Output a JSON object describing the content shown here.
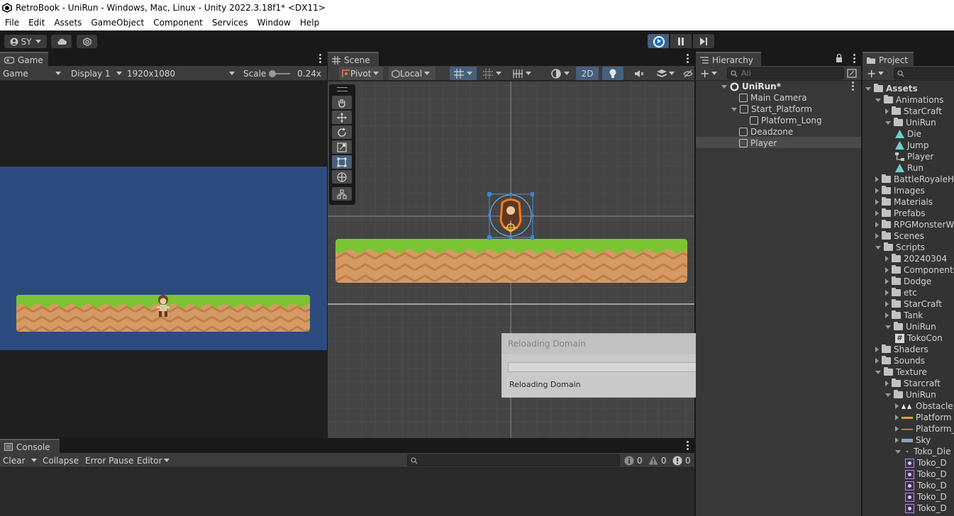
{
  "window": {
    "title": "RetroBook - UniRun - Windows, Mac, Linux - Unity 2022.3.18f1* <DX11>"
  },
  "menu": [
    "File",
    "Edit",
    "Assets",
    "GameObject",
    "Component",
    "Services",
    "Window",
    "Help"
  ],
  "toolbar": {
    "account": "SY"
  },
  "game": {
    "tab": "Game",
    "view_mode": "Game",
    "display": "Display 1",
    "resolution": "1920x1080",
    "scale_label": "Scale",
    "scale_value": "0.24x",
    "sky_color": "#2c4c80"
  },
  "scene": {
    "tab": "Scene",
    "pivot": "Pivot",
    "space": "Local",
    "mode_2d": "2D",
    "dialog": {
      "title": "Reloading Domain",
      "message": "Reloading Domain"
    }
  },
  "hierarchy": {
    "tab": "Hierarchy",
    "search_placeholder": "All",
    "scene_name": "UniRun*",
    "items": [
      {
        "label": "Main Camera"
      },
      {
        "label": "Start_Platform"
      },
      {
        "label": "Platform_Long"
      },
      {
        "label": "Deadzone"
      },
      {
        "label": "Player"
      }
    ]
  },
  "project": {
    "tab": "Project",
    "root": "Assets",
    "items": [
      {
        "label": "Animations"
      },
      {
        "label": "StarCraft"
      },
      {
        "label": "UniRun"
      },
      {
        "label": "Die"
      },
      {
        "label": "Jump"
      },
      {
        "label": "Player"
      },
      {
        "label": "Run"
      },
      {
        "label": "BattleRoyaleHe"
      },
      {
        "label": "Images"
      },
      {
        "label": "Materials"
      },
      {
        "label": "Prefabs"
      },
      {
        "label": "RPGMonsterW"
      },
      {
        "label": "Scenes"
      },
      {
        "label": "Scripts"
      },
      {
        "label": "20240304"
      },
      {
        "label": "Components"
      },
      {
        "label": "Dodge"
      },
      {
        "label": "etc"
      },
      {
        "label": "StarCraft"
      },
      {
        "label": "Tank"
      },
      {
        "label": "UniRun"
      },
      {
        "label": "TokoCon"
      },
      {
        "label": "Shaders"
      },
      {
        "label": "Sounds"
      },
      {
        "label": "Texture"
      },
      {
        "label": "Starcraft"
      },
      {
        "label": "UniRun"
      },
      {
        "label": "Obstacle"
      },
      {
        "label": "Platform"
      },
      {
        "label": "Platform_"
      },
      {
        "label": "Sky"
      },
      {
        "label": "Toko_Die"
      },
      {
        "label": "Toko_D"
      },
      {
        "label": "Toko_D"
      },
      {
        "label": "Toko_D"
      },
      {
        "label": "Toko_D"
      },
      {
        "label": "Toko_D"
      }
    ]
  },
  "console": {
    "tab": "Console",
    "clear": "Clear",
    "collapse": "Collapse",
    "error_pause": "Error Pause",
    "editor": "Editor",
    "log_count": "0",
    "warn_count": "0",
    "error_count": "0"
  }
}
